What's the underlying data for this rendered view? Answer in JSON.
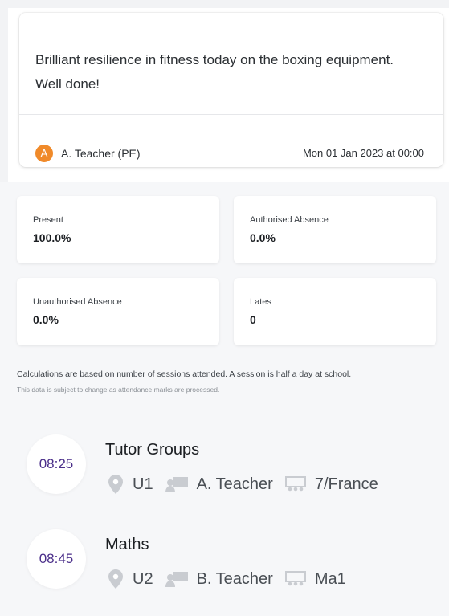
{
  "comment": {
    "text": "Brilliant resilience in fitness today on the boxing equipment. Well done!",
    "author_initial": "A",
    "author": "A. Teacher (PE)",
    "date": "Mon 01 Jan 2023 at 00:00",
    "avatar_color": "#f08a2a"
  },
  "attendance": {
    "present": {
      "label": "Present",
      "value": "100.0%"
    },
    "authorised": {
      "label": "Authorised Absence",
      "value": "0.0%"
    },
    "unauthorised": {
      "label": "Unauthorised Absence",
      "value": "0.0%"
    },
    "lates": {
      "label": "Lates",
      "value": "0"
    },
    "note": "Calculations are based on number of sessions attended. A session is half a day at school.",
    "subnote": "This data is subject to change as attendance marks are processed."
  },
  "timetable": [
    {
      "time": "08:25",
      "title": "Tutor Groups",
      "room": "U1",
      "teacher": "A. Teacher",
      "group": "7/France"
    },
    {
      "time": "08:45",
      "title": "Maths",
      "room": "U2",
      "teacher": "B. Teacher",
      "group": "Ma1"
    }
  ],
  "colors": {
    "time_text": "#4b2f8a",
    "icon": "#c9ccd1"
  }
}
